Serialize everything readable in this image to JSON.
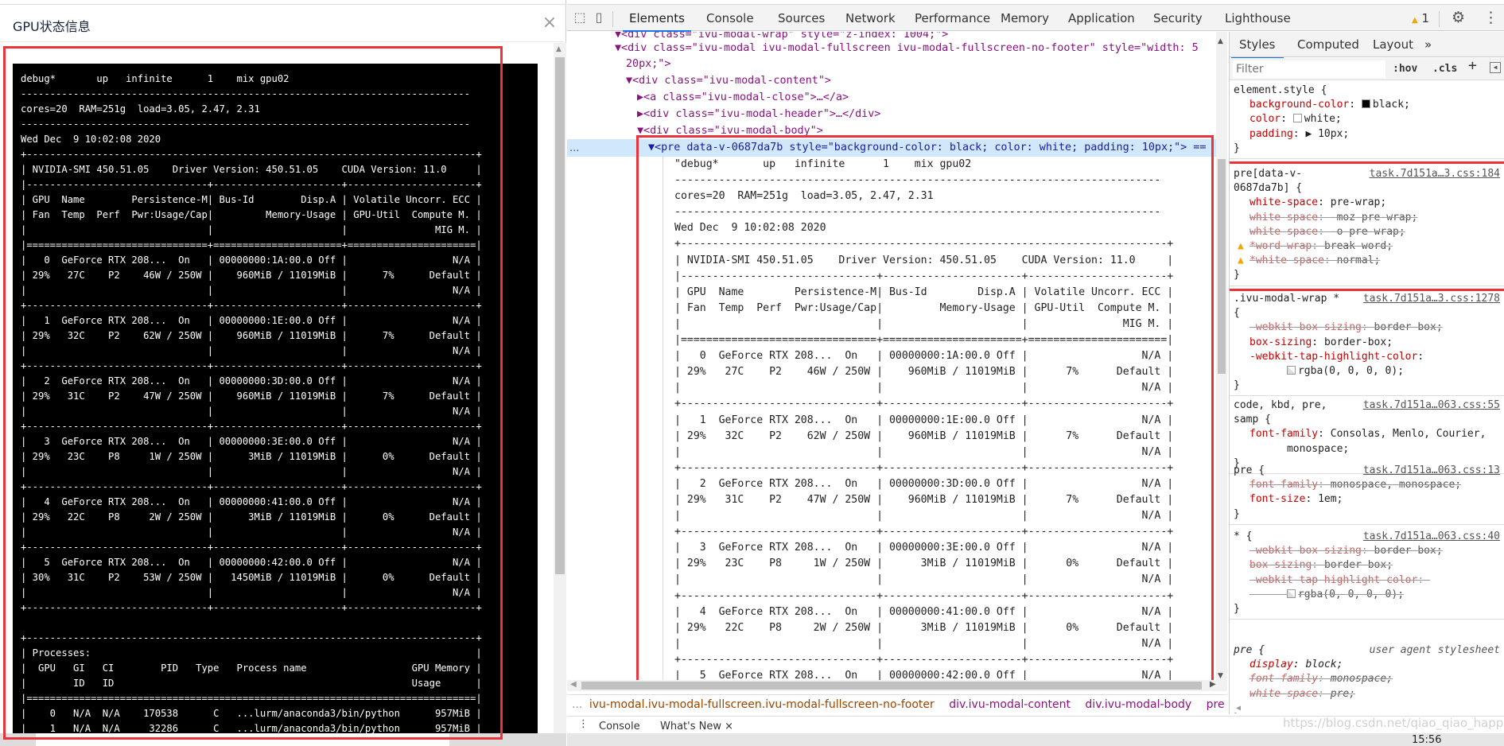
{
  "modal": {
    "title": "GPU状态信息",
    "close_icon": "×",
    "pre_text": "debug*       up   infinite      1    mix gpu02\n-----------------------------------------------------------------------------\ncores=20  RAM=251g  load=3.05, 2.47, 2.31\n-----------------------------------------------------------------------------\nWed Dec  9 10:02:08 2020\n+-----------------------------------------------------------------------------+\n| NVIDIA-SMI 450.51.05    Driver Version: 450.51.05    CUDA Version: 11.0     |\n|-------------------------------+----------------------+----------------------+\n| GPU  Name        Persistence-M| Bus-Id        Disp.A | Volatile Uncorr. ECC |\n| Fan  Temp  Perf  Pwr:Usage/Cap|         Memory-Usage | GPU-Util  Compute M. |\n|                               |                      |               MIG M. |\n|===============================+======================+======================|\n|   0  GeForce RTX 208...  On   | 00000000:1A:00.0 Off |                  N/A |\n| 29%   27C    P2    46W / 250W |    960MiB / 11019MiB |      7%      Default |\n|                               |                      |                  N/A |\n+-------------------------------+----------------------+----------------------+\n|   1  GeForce RTX 208...  On   | 00000000:1E:00.0 Off |                  N/A |\n| 29%   32C    P2    62W / 250W |    960MiB / 11019MiB |      7%      Default |\n|                               |                      |                  N/A |\n+-------------------------------+----------------------+----------------------+\n|   2  GeForce RTX 208...  On   | 00000000:3D:00.0 Off |                  N/A |\n| 29%   31C    P2    47W / 250W |    960MiB / 11019MiB |      7%      Default |\n|                               |                      |                  N/A |\n+-------------------------------+----------------------+----------------------+\n|   3  GeForce RTX 208...  On   | 00000000:3E:00.0 Off |                  N/A |\n| 29%   23C    P8     1W / 250W |      3MiB / 11019MiB |      0%      Default |\n|                               |                      |                  N/A |\n+-------------------------------+----------------------+----------------------+\n|   4  GeForce RTX 208...  On   | 00000000:41:00.0 Off |                  N/A |\n| 29%   22C    P8     2W / 250W |      3MiB / 11019MiB |      0%      Default |\n|                               |                      |                  N/A |\n+-------------------------------+----------------------+----------------------+\n|   5  GeForce RTX 208...  On   | 00000000:42:00.0 Off |                  N/A |\n| 30%   31C    P2    53W / 250W |   1450MiB / 11019MiB |      0%      Default |\n|                               |                      |                  N/A |\n+-------------------------------+----------------------+----------------------+\n\n+-----------------------------------------------------------------------------+\n| Processes:                                                                  |\n|  GPU   GI   CI        PID   Type   Process name                  GPU Memory |\n|        ID   ID                                                   Usage      |\n|=============================================================================|\n|    0   N/A  N/A    170538      C   ...lurm/anaconda3/bin/python      957MiB |\n|    1   N/A  N/A     32286      C   ...lurm/anaconda3/bin/python      957MiB |"
  },
  "devtools": {
    "tabs": [
      "Elements",
      "Console",
      "Sources",
      "Network",
      "Performance",
      "Memory",
      "Application",
      "Security",
      "Lighthouse"
    ],
    "active_tab": "Elements",
    "warning_count": "1",
    "elements": {
      "nodes": [
        "▼<div class=\"ivu-modal-wrap\" style=\"z-index: 1004;\">",
        "▼<div class=\"ivu-modal ivu-modal-fullscreen ivu-modal-fullscreen-no-footer\" style=\"width: 5",
        "20px;\">",
        "▼<div class=\"ivu-modal-content\">",
        "▶<a class=\"ivu-modal-close\">…</a>",
        "▶<div class=\"ivu-modal-header\">…</div>",
        "▼<div class=\"ivu-modal-body\">",
        "▼<pre data-v-0687da7b style=\"background-color: black; color: white; padding: 10px;\"> =="
      ],
      "selected_dots": "...",
      "text_content": "\"debug*       up   infinite      1    mix gpu02\n-----------------------------------------------------------------------------\ncores=20  RAM=251g  load=3.05, 2.47, 2.31\n-----------------------------------------------------------------------------\nWed Dec  9 10:02:08 2020\n+-----------------------------------------------------------------------------+\n| NVIDIA-SMI 450.51.05    Driver Version: 450.51.05    CUDA Version: 11.0     |\n|-------------------------------+----------------------+----------------------+\n| GPU  Name        Persistence-M| Bus-Id        Disp.A | Volatile Uncorr. ECC |\n| Fan  Temp  Perf  Pwr:Usage/Cap|         Memory-Usage | GPU-Util  Compute M. |\n|                               |                      |               MIG M. |\n|===============================+======================+======================|\n|   0  GeForce RTX 208...  On   | 00000000:1A:00.0 Off |                  N/A |\n| 29%   27C    P2    46W / 250W |    960MiB / 11019MiB |      7%      Default |\n|                               |                      |                  N/A |\n+-------------------------------+----------------------+----------------------+\n|   1  GeForce RTX 208...  On   | 00000000:1E:00.0 Off |                  N/A |\n| 29%   32C    P2    62W / 250W |    960MiB / 11019MiB |      7%      Default |\n|                               |                      |                  N/A |\n+-------------------------------+----------------------+----------------------+\n|   2  GeForce RTX 208...  On   | 00000000:3D:00.0 Off |                  N/A |\n| 29%   31C    P2    47W / 250W |    960MiB / 11019MiB |      7%      Default |\n|                               |                      |                  N/A |\n+-------------------------------+----------------------+----------------------+\n|   3  GeForce RTX 208...  On   | 00000000:3E:00.0 Off |                  N/A |\n| 29%   23C    P8     1W / 250W |      3MiB / 11019MiB |      0%      Default |\n|                               |                      |                  N/A |\n+-------------------------------+----------------------+----------------------+\n|   4  GeForce RTX 208...  On   | 00000000:41:00.0 Off |                  N/A |\n| 29%   22C    P8     2W / 250W |      3MiB / 11019MiB |      0%      Default |\n|                               |                      |                  N/A |\n+-------------------------------+----------------------+----------------------+\n|   5  GeForce RTX 208...  On   | 00000000:42:00.0 Off |                  N/A |"
    },
    "breadcrumb": {
      "leading": "...",
      "items": [
        "ivu-modal.ivu-modal-fullscreen.ivu-modal-fullscreen-no-footer",
        "div.ivu-modal-content",
        "div.ivu-modal-body",
        "pre"
      ],
      "trailing": "..."
    },
    "drawer": {
      "tabs": [
        "Console",
        "What's New"
      ],
      "close": "×"
    },
    "styles": {
      "tabs": [
        "Styles",
        "Computed",
        "Layout",
        "»"
      ],
      "filter_placeholder": "Filter",
      "hov": ":hov",
      "cls": ".cls",
      "plus": "+",
      "rules": [
        {
          "selector": "element.style {",
          "source": "",
          "props": [
            {
              "name": "background-color",
              "value": "black;",
              "swatch": "#000000"
            },
            {
              "name": "color",
              "value": "white;",
              "swatch": "#ffffff"
            },
            {
              "name": "padding",
              "value": "▶ 10px;"
            }
          ]
        },
        {
          "selector": "pre[data-v-\n0687da7b] {",
          "source": "task.7d151a…3.css:184",
          "props": [
            {
              "name": "white-space",
              "value": "pre-wrap;"
            },
            {
              "name": "white-space",
              "value": "-moz-pre-wrap;",
              "struck": true
            },
            {
              "name": "white-space",
              "value": "-o-pre-wrap;",
              "struck": true
            },
            {
              "name": "*word-wrap",
              "value": "break-word;",
              "struck": true,
              "warning": true
            },
            {
              "name": "*white-space",
              "value": "normal;",
              "struck": true,
              "warning": true
            }
          ]
        },
        {
          "selector": ".ivu-modal-wrap *\n{",
          "source": "task.7d151a…3.css:1278",
          "props": [
            {
              "name": "-webkit-box-sizing",
              "value": "border-box;",
              "struck": true
            },
            {
              "name": "box-sizing",
              "value": "border-box;"
            },
            {
              "name": "-webkit-tap-highlight-color",
              "value": "\n      rgba(0, 0, 0, 0);",
              "swatch": "transparent"
            }
          ]
        },
        {
          "selector": "code, kbd, pre,\nsamp {",
          "source": "task.7d151a…063.css:55",
          "props": [
            {
              "name": "font-family",
              "value": "Consolas, Menlo, Courier,\n      monospace;"
            }
          ]
        },
        {
          "selector": "pre {",
          "source": "task.7d151a…063.css:13",
          "props": [
            {
              "name": "font-family",
              "value": "monospace, monospace;",
              "struck": true
            },
            {
              "name": "font-size",
              "value": "1em;"
            }
          ]
        },
        {
          "selector": "* {",
          "source": "task.7d151a…063.css:40",
          "props": [
            {
              "name": "-webkit-box-sizing",
              "value": "border-box;",
              "struck": true
            },
            {
              "name": "box-sizing",
              "value": "border-box;",
              "struck": true
            },
            {
              "name": "-webkit-tap-highlight-color",
              "value": "\n      rgba(0, 0, 0, 0);",
              "struck": true,
              "swatch": "transparent"
            }
          ]
        },
        {
          "selector": "pre {",
          "source": "user agent stylesheet",
          "ua": true,
          "props": [
            {
              "name": "display",
              "value": "block;"
            },
            {
              "name": "font-family",
              "value": "monospace;",
              "struck": true
            },
            {
              "name": "white-space",
              "value": "pre;",
              "struck": true
            }
          ]
        }
      ]
    }
  },
  "watermark": "https://blog.csdn.net/qiao_qiao_happy",
  "clock": "15:56",
  "colors": {
    "highlight_red": "#e8343a",
    "selected_row": "#cfe8fc",
    "active_tab_underline": "#1a73e8",
    "warning": "#f2a600"
  }
}
